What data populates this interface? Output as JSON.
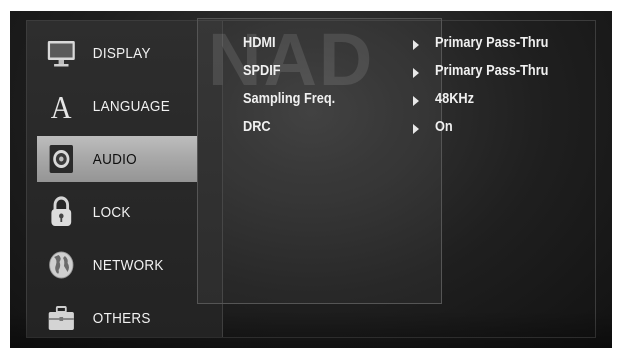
{
  "watermark": "NAD",
  "menu": {
    "items": [
      {
        "label": "DISPLAY",
        "icon": "display-icon",
        "selected": false
      },
      {
        "label": "LANGUAGE",
        "icon": "language-icon",
        "selected": false
      },
      {
        "label": "AUDIO",
        "icon": "speaker-icon",
        "selected": true
      },
      {
        "label": "LOCK",
        "icon": "padlock-icon",
        "selected": false
      },
      {
        "label": "NETWORK",
        "icon": "globe-icon",
        "selected": false
      },
      {
        "label": "OTHERS",
        "icon": "toolbox-icon",
        "selected": false
      }
    ]
  },
  "settings": [
    {
      "name": "HDMI",
      "value": "Primary Pass-Thru"
    },
    {
      "name": "SPDIF",
      "value": "Primary Pass-Thru"
    },
    {
      "name": "Sampling Freq.",
      "value": "48KHz"
    },
    {
      "name": "DRC",
      "value": "On"
    }
  ],
  "colors": {
    "background": "#1f1f1f",
    "selected_highlight": "#a9a9a9",
    "text": "#f2f2f2"
  }
}
